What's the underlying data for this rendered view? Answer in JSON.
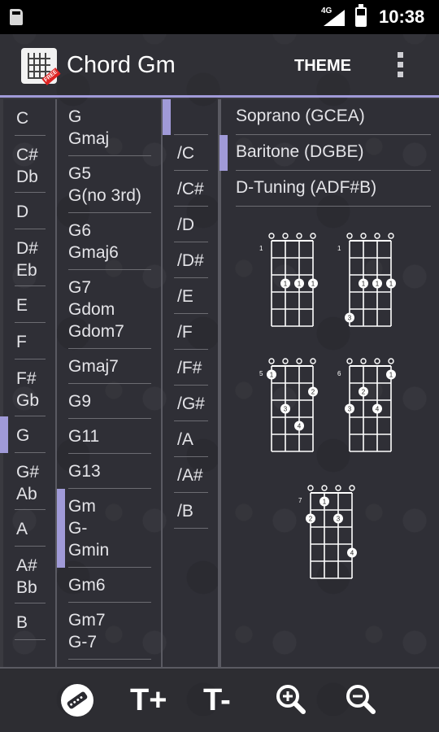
{
  "status_bar": {
    "network": "4G",
    "time": "10:38"
  },
  "app_bar": {
    "title": "Chord Gm",
    "theme_label": "THEME",
    "free_badge": "FREE"
  },
  "roots": [
    {
      "label": "C"
    },
    {
      "label": "C#\nDb"
    },
    {
      "label": "D"
    },
    {
      "label": "D#\nEb"
    },
    {
      "label": "E"
    },
    {
      "label": "F"
    },
    {
      "label": "F#\nGb"
    },
    {
      "label": "G",
      "selected": true
    },
    {
      "label": "G#\nAb"
    },
    {
      "label": "A"
    },
    {
      "label": "A#\nBb"
    },
    {
      "label": "B"
    }
  ],
  "chord_types": [
    {
      "label": "G\nGmaj"
    },
    {
      "label": "G5\nG(no 3rd)"
    },
    {
      "label": "G6\nGmaj6"
    },
    {
      "label": "G7\nGdom\nGdom7"
    },
    {
      "label": "Gmaj7"
    },
    {
      "label": "G9"
    },
    {
      "label": "G11"
    },
    {
      "label": "G13"
    },
    {
      "label": "Gm\nG-\nGmin",
      "selected": true
    },
    {
      "label": "Gm6"
    },
    {
      "label": "Gm7\nG-7"
    }
  ],
  "bass_notes": [
    {
      "label": "",
      "selected": true
    },
    {
      "label": "/C"
    },
    {
      "label": "/C#"
    },
    {
      "label": "/D"
    },
    {
      "label": "/D#"
    },
    {
      "label": "/E"
    },
    {
      "label": "/F"
    },
    {
      "label": "/F#"
    },
    {
      "label": "/G#"
    },
    {
      "label": "/A"
    },
    {
      "label": "/A#"
    },
    {
      "label": "/B"
    }
  ],
  "tunings": [
    {
      "label": "Soprano (GCEA)"
    },
    {
      "label": "Baritone (DGBE)",
      "selected": true
    },
    {
      "label": "D-Tuning (ADF#B)"
    }
  ],
  "diagrams": [
    {
      "fret": "1",
      "open": [
        true,
        true,
        true,
        true
      ],
      "dots": [
        {
          "s": 1,
          "f": 2,
          "n": "1"
        },
        {
          "s": 2,
          "f": 2,
          "n": "1"
        },
        {
          "s": 3,
          "f": 2,
          "n": "1"
        }
      ]
    },
    {
      "fret": "1",
      "open": [
        true,
        true,
        true,
        true
      ],
      "dots": [
        {
          "s": 1,
          "f": 2,
          "n": "1"
        },
        {
          "s": 2,
          "f": 2,
          "n": "1"
        },
        {
          "s": 3,
          "f": 2,
          "n": "1"
        },
        {
          "s": 0,
          "f": 4,
          "n": "3"
        }
      ]
    },
    {
      "fret": "5",
      "open": [
        true,
        true,
        true,
        true
      ],
      "dots": [
        {
          "s": 0,
          "f": 0,
          "n": "1"
        },
        {
          "s": 3,
          "f": 1,
          "n": "2"
        },
        {
          "s": 1,
          "f": 2,
          "n": "3"
        },
        {
          "s": 2,
          "f": 3,
          "n": "4"
        }
      ]
    },
    {
      "fret": "6",
      "open": [
        true,
        true,
        true,
        true
      ],
      "dots": [
        {
          "s": 3,
          "f": 0,
          "n": "1"
        },
        {
          "s": 1,
          "f": 1,
          "n": "2"
        },
        {
          "s": 0,
          "f": 2,
          "n": "3"
        },
        {
          "s": 2,
          "f": 2,
          "n": "4"
        }
      ]
    },
    {
      "fret": "7",
      "open": [
        true,
        true,
        true,
        true
      ],
      "dots": [
        {
          "s": 1,
          "f": 0,
          "n": "1"
        },
        {
          "s": 0,
          "f": 1,
          "n": "2"
        },
        {
          "s": 2,
          "f": 1,
          "n": "3"
        },
        {
          "s": 3,
          "f": 3,
          "n": "4"
        }
      ]
    }
  ],
  "toolbar": {
    "text_inc": "T+",
    "text_dec": "T-"
  },
  "colors": {
    "accent": "#a09ad8",
    "background": "#3a3a40"
  }
}
